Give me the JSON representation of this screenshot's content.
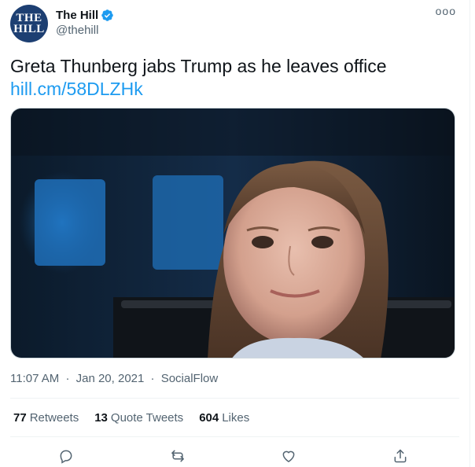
{
  "account": {
    "avatar_text_line1": "THE",
    "avatar_text_line2": "HILL",
    "display_name": "The Hill",
    "handle": "@thehill",
    "verified": true
  },
  "more_menu": "ooo",
  "tweet": {
    "text": "Greta Thunberg jabs Trump as he leaves office",
    "link": "hill.cm/58DLZHk"
  },
  "meta": {
    "time": "11:07 AM",
    "separator1": "·",
    "date": "Jan 20, 2021",
    "separator2": "·",
    "source": "SocialFlow"
  },
  "stats": {
    "retweets_count": "77",
    "retweets_label": "Retweets",
    "quote_count": "13",
    "quote_label": "Quote Tweets",
    "likes_count": "604",
    "likes_label": "Likes"
  },
  "actions": [
    "reply-icon",
    "retweet-icon",
    "like-icon",
    "share-icon"
  ],
  "colors": {
    "link": "#1d9bf0",
    "verified": "#1d9bf0",
    "secondary_text": "#536471",
    "avatar_bg": "#1d3f72"
  }
}
